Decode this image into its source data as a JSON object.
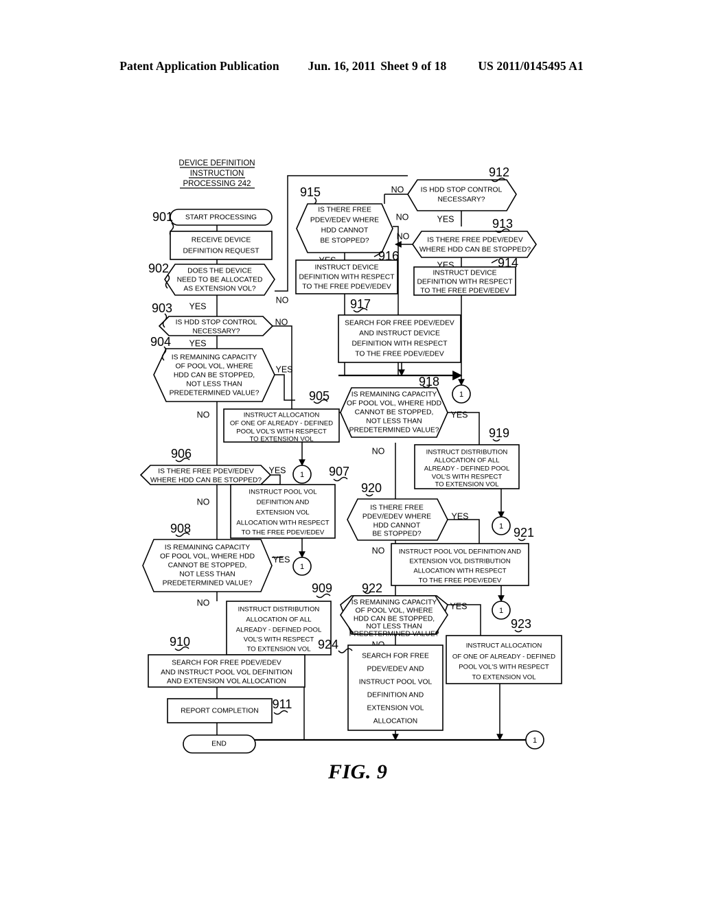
{
  "header": {
    "publication": "Patent Application Publication",
    "date": "Jun. 16, 2011",
    "sheet": "Sheet 9 of 18",
    "patent_number": "US 2011/0145495 A1"
  },
  "figure": {
    "caption": "FIG. 9",
    "diagram_title_line1": "DEVICE DEFINITION",
    "diagram_title_line2": "INSTRUCTION",
    "diagram_title_line3": "PROCESSING 242"
  },
  "connector_label": "1",
  "branch_labels": {
    "yes": "YES",
    "no": "NO"
  },
  "nodes": [
    {
      "ref": "901",
      "shape": "terminator",
      "lines": [
        "START PROCESSING"
      ]
    },
    {
      "ref": "",
      "shape": "process",
      "lines": [
        "RECEIVE DEVICE",
        "DEFINITION REQUEST"
      ]
    },
    {
      "ref": "902",
      "shape": "decision",
      "lines": [
        "DOES THE DEVICE",
        "NEED TO BE ALLOCATED",
        "AS EXTENSION VOL?"
      ]
    },
    {
      "ref": "903",
      "shape": "decision",
      "lines": [
        "IS HDD STOP CONTROL",
        "NECESSARY?"
      ]
    },
    {
      "ref": "904",
      "shape": "decision",
      "lines": [
        "IS REMAINING CAPACITY",
        "OF POOL VOL, WHERE",
        "HDD CAN BE STOPPED,",
        "NOT LESS THAN",
        "PREDETERMINED VALUE?"
      ]
    },
    {
      "ref": "905",
      "shape": "process",
      "lines": [
        "INSTRUCT ALLOCATION",
        "OF ONE OF ALREADY - DEFINED",
        "POOL VOL'S WITH RESPECT",
        "TO EXTENSION VOL"
      ]
    },
    {
      "ref": "906",
      "shape": "decision",
      "lines": [
        "IS THERE FREE PDEV/EDEV",
        "WHERE HDD CAN BE STOPPED?"
      ]
    },
    {
      "ref": "907",
      "shape": "process",
      "lines": [
        "INSTRUCT POOL VOL",
        "DEFINITION AND",
        "EXTENSION VOL",
        "ALLOCATION WITH RESPECT",
        "TO THE FREE PDEV/EDEV"
      ]
    },
    {
      "ref": "908",
      "shape": "decision",
      "lines": [
        "IS REMAINING CAPACITY",
        "OF POOL VOL, WHERE HDD",
        "CANNOT BE STOPPED,",
        "NOT LESS THAN",
        "PREDETERMINED VALUE?"
      ]
    },
    {
      "ref": "909",
      "shape": "process",
      "lines": [
        "INSTRUCT DISTRIBUTION",
        "ALLOCATION OF ALL",
        "ALREADY - DEFINED POOL",
        "VOL'S  WITH RESPECT",
        "TO EXTENSION VOL"
      ]
    },
    {
      "ref": "910",
      "shape": "process",
      "lines": [
        "SEARCH FOR FREE PDEV/EDEV",
        "AND INSTRUCT POOL VOL DEFINITION",
        "AND EXTENSION VOL ALLOCATION"
      ]
    },
    {
      "ref": "911",
      "shape": "process",
      "lines": [
        "REPORT COMPLETION"
      ]
    },
    {
      "ref": "",
      "shape": "terminator",
      "lines": [
        "END"
      ]
    },
    {
      "ref": "912",
      "shape": "decision",
      "lines": [
        "IS HDD STOP CONTROL",
        "NECESSARY?"
      ]
    },
    {
      "ref": "913",
      "shape": "decision",
      "lines": [
        "IS THERE FREE PDEV/EDEV",
        "WHERE HDD CAN BE STOPPED?"
      ]
    },
    {
      "ref": "914",
      "shape": "process",
      "lines": [
        "INSTRUCT DEVICE",
        "DEFINITION WITH RESPECT",
        "TO THE FREE PDEV/EDEV"
      ]
    },
    {
      "ref": "915",
      "shape": "decision",
      "lines": [
        "IS THERE FREE",
        "PDEV/EDEV WHERE",
        "HDD CANNOT",
        "BE STOPPED?"
      ]
    },
    {
      "ref": "916",
      "shape": "process",
      "lines": [
        "INSTRUCT DEVICE",
        "DEFINITION WITH RESPECT",
        "TO THE FREE PDEV/EDEV"
      ]
    },
    {
      "ref": "917",
      "shape": "process",
      "lines": [
        "SEARCH FOR FREE PDEV/EDEV",
        "AND INSTRUCT DEVICE",
        "DEFINITION WITH RESPECT",
        "TO THE FREE PDEV/EDEV"
      ]
    },
    {
      "ref": "918",
      "shape": "decision",
      "lines": [
        "IS REMAINING CAPACITY",
        "OF POOL VOL, WHERE HDD",
        "CANNOT BE STOPPED,",
        "NOT LESS THAN",
        "PREDETERMINED VALUE?"
      ]
    },
    {
      "ref": "919",
      "shape": "process",
      "lines": [
        "INSTRUCT DISTRIBUTION",
        "ALLOCATION OF ALL",
        "ALREADY - DEFINED POOL",
        "VOL'S  WITH RESPECT",
        "TO EXTENSION VOL"
      ]
    },
    {
      "ref": "920",
      "shape": "decision",
      "lines": [
        "IS THERE FREE",
        "PDEV/EDEV WHERE",
        "HDD CANNOT",
        "BE STOPPED?"
      ]
    },
    {
      "ref": "921",
      "shape": "process",
      "lines": [
        "INSTRUCT POOL VOL DEFINITION AND",
        "EXTENSION VOL DISTRIBUTION",
        "ALLOCATION WITH RESPECT",
        "TO THE FREE PDEV/EDEV"
      ]
    },
    {
      "ref": "922",
      "shape": "decision",
      "lines": [
        "IS REMAINING CAPACITY",
        "OF POOL VOL, WHERE",
        "HDD CAN BE STOPPED,",
        "NOT LESS THAN",
        "PREDETERMINED VALUE?"
      ]
    },
    {
      "ref": "923",
      "shape": "process",
      "lines": [
        "INSTRUCT ALLOCATION",
        "OF ONE OF ALREADY - DEFINED",
        "POOL VOL'S WITH RESPECT",
        "TO EXTENSION VOL"
      ]
    },
    {
      "ref": "924",
      "shape": "process",
      "lines": [
        "SEARCH FOR FREE",
        "PDEV/EDEV AND",
        "INSTRUCT POOL VOL",
        "DEFINITION AND",
        "EXTENSION VOL",
        "ALLOCATION"
      ]
    }
  ]
}
